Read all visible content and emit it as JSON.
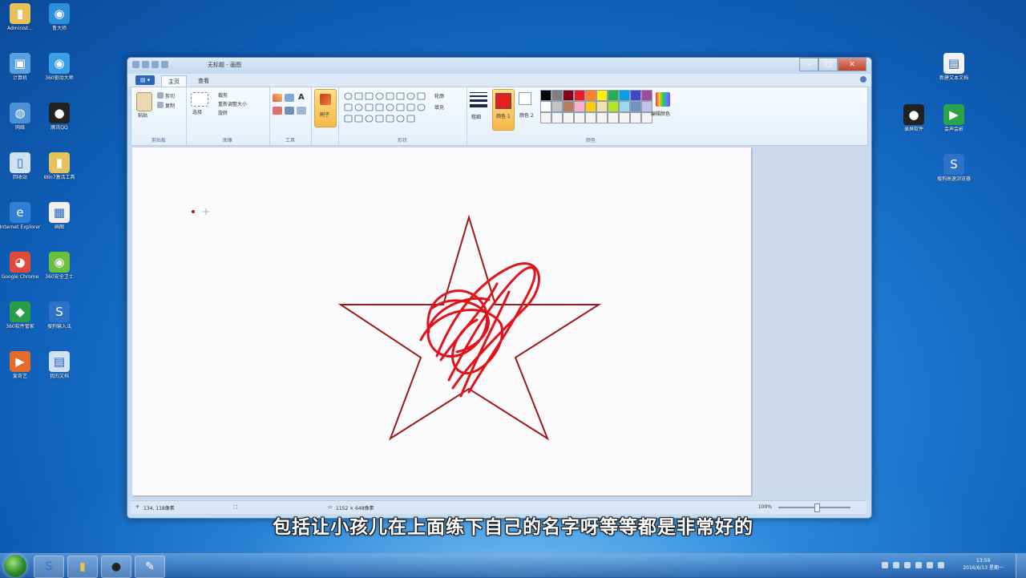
{
  "desktop": {
    "left_icons": [
      {
        "label": "Administ...",
        "icon": "folder-icon",
        "color": "#e9c15a",
        "glyph": "▮"
      },
      {
        "label": "鲁大师",
        "icon": "ludashi-icon",
        "color": "#2a8fd6",
        "glyph": "◉"
      },
      {
        "label": "计算机",
        "icon": "computer-icon",
        "color": "#5aa0e0",
        "glyph": "▣"
      },
      {
        "label": "360驱动大师",
        "icon": "driver-master-icon",
        "color": "#3aa0e6",
        "glyph": "◉"
      },
      {
        "label": "网络",
        "icon": "network-icon",
        "color": "#4a90d8",
        "glyph": "◍"
      },
      {
        "label": "腾讯QQ",
        "icon": "qq-icon",
        "color": "#222222",
        "glyph": "●"
      },
      {
        "label": "回收站",
        "icon": "recycle-bin-icon",
        "color": "#cfe2f3",
        "glyph": "▯"
      },
      {
        "label": "Win7激活工具",
        "icon": "folder-icon",
        "color": "#e9c15a",
        "glyph": "▮"
      },
      {
        "label": "Internet Explorer",
        "icon": "ie-icon",
        "color": "#2f7fd6",
        "glyph": "e"
      },
      {
        "label": "画图",
        "icon": "paint-icon",
        "color": "#f0f0f0",
        "glyph": "▦"
      },
      {
        "label": "Google Chrome",
        "icon": "chrome-icon",
        "color": "#e04a3a",
        "glyph": "◕"
      },
      {
        "label": "360安全卫士",
        "icon": "360-safe-icon",
        "color": "#6cbf3a",
        "glyph": "◉"
      },
      {
        "label": "360软件管家",
        "icon": "software-manager-icon",
        "color": "#2a9d4a",
        "glyph": "◆"
      },
      {
        "label": "搜狗输入法",
        "icon": "sogou-icon",
        "color": "#2e72c8",
        "glyph": "S"
      },
      {
        "label": "爱奇艺",
        "icon": "video-icon",
        "color": "#e86a2a",
        "glyph": "▶"
      },
      {
        "label": "我的文档",
        "icon": "documents-icon",
        "color": "#cfe2f3",
        "glyph": "▤"
      }
    ],
    "right_icons": [
      {
        "label": "新建文本文档",
        "icon": "text-document-icon",
        "color": "#f2f2f2",
        "glyph": "▤"
      },
      {
        "label": "录屏软件",
        "icon": "recorder-icon",
        "color": "#222222",
        "glyph": "●"
      },
      {
        "label": "会声会影",
        "icon": "video-editor-icon",
        "color": "#2aa34a",
        "glyph": "▶"
      },
      {
        "label": "搜狗高速浏览器",
        "icon": "sogou-browser-icon",
        "color": "#2e72c8",
        "glyph": "S"
      }
    ]
  },
  "window": {
    "title": "无标题 - 画图",
    "menu_button": "▤ ▾",
    "tabs": [
      "主页",
      "查看"
    ],
    "minimize": "–",
    "maximize": "□",
    "close": "✕",
    "ribbon": {
      "clipboard": {
        "paste": "粘贴",
        "cut": "剪切",
        "copy": "复制",
        "group": "剪贴板"
      },
      "image": {
        "select": "选择",
        "crop": "裁剪",
        "resize": "重新调整大小",
        "rotate": "旋转",
        "group": "图像"
      },
      "tools": {
        "group": "工具"
      },
      "brushes": {
        "label": "刷子"
      },
      "shapes": {
        "outline": "轮廓",
        "fill": "填充",
        "group": "形状"
      },
      "size": {
        "label": "粗细"
      },
      "color1": {
        "label": "颜色 1",
        "value": "#e32020"
      },
      "color2": {
        "label": "颜色 2",
        "value": "#ffffff"
      },
      "colors": {
        "edit": "编辑颜色",
        "group": "颜色"
      },
      "palette": [
        "#000000",
        "#7f7f7f",
        "#880015",
        "#ed1c24",
        "#ff7f27",
        "#fff200",
        "#22b14c",
        "#00a2e8",
        "#3f48cc",
        "#a349a4",
        "#ffffff",
        "#c3c3c3",
        "#b97a57",
        "#ffaec9",
        "#ffc90e",
        "#efe4b0",
        "#b5e61d",
        "#99d9ea",
        "#7092be",
        "#c8bfe7",
        "#f4f4f4",
        "#f4f4f4",
        "#f4f4f4",
        "#f4f4f4",
        "#f4f4f4",
        "#f4f4f4",
        "#f4f4f4",
        "#f4f4f4",
        "#f4f4f4",
        "#f4f4f4"
      ]
    },
    "status": {
      "cursor_pos": "134, 118像素",
      "canvas_size": "1152 × 648像素",
      "zoom": "100%"
    }
  },
  "subtitle": "包括让小孩儿在上面练下自己的名字呀等等都是非常好的",
  "taskbar": {
    "buttons": [
      {
        "icon": "sogou-browser-icon",
        "glyph": "S",
        "color": "#2e72c8"
      },
      {
        "icon": "explorer-icon",
        "glyph": "▮",
        "color": "#e9c15a"
      },
      {
        "icon": "recorder-icon",
        "glyph": "●",
        "color": "#222222"
      },
      {
        "icon": "paint-icon",
        "glyph": "✎",
        "color": "#f0f0f0"
      }
    ],
    "time": "13:59",
    "date": "2016/6/13 星期一"
  }
}
